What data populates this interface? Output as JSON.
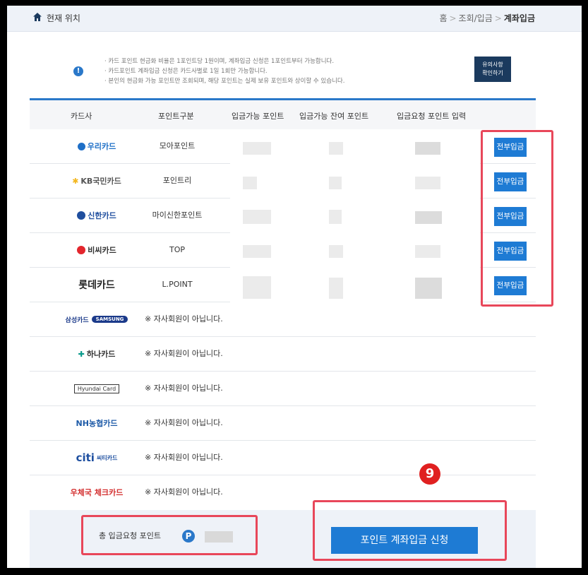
{
  "header": {
    "location_label": "현재 위치",
    "breadcrumb": [
      "홈",
      "조회/입금",
      "계좌입금"
    ],
    "separator": ">"
  },
  "notice": {
    "lines": [
      "· 카드 포인트 현금화 비율은 1포인트당 1원이며, 계좌입금 신청은 1포인트부터 가능합니다.",
      "· 카드포인트 계좌입금 신청은 카드사별로 1일 1회만 가능합니다.",
      "· 본인의 현금화 가능 포인트만 조회되며, 해당 포인트는 실제 보유 포인트와 상이할 수 있습니다."
    ],
    "caution_button": [
      "유의사항",
      "확인하기"
    ]
  },
  "table": {
    "headers": [
      "카드사",
      "포인트구분",
      "입금가능 포인트",
      "입금가능 잔여 포인트",
      "입금요청 포인트 입력"
    ],
    "member_rows": [
      {
        "card": "우리카드",
        "point_type": "모아포인트",
        "action": "전부입금"
      },
      {
        "card": "KB국민카드",
        "point_type": "포인트리",
        "action": "전부입금"
      },
      {
        "card": "신한카드",
        "point_type": "마이신한포인트",
        "action": "전부입금"
      },
      {
        "card": "비씨카드",
        "point_type": "TOP",
        "action": "전부입금"
      },
      {
        "card": "롯데카드",
        "point_type": "L.POINT",
        "action": "전부입금"
      }
    ],
    "nonmember_rows": [
      {
        "card": "삼성카드",
        "card_sub": "SAMSUNG",
        "status": "※ 자사회원이 아닙니다."
      },
      {
        "card": "하나카드",
        "status": "※ 자사회원이 아닙니다."
      },
      {
        "card": "Hyundai Card",
        "status": "※ 자사회원이 아닙니다."
      },
      {
        "card": "NH농협카드",
        "status": "※ 자사회원이 아닙니다."
      },
      {
        "card": "citi",
        "card_sub": "씨티카드",
        "status": "※ 자사회원이 아닙니다."
      },
      {
        "card": "우체국 체크카드",
        "status": "※ 자사회원이 아닙니다."
      }
    ]
  },
  "footer": {
    "total_label": "총 입금요청 포인트",
    "point_icon": "P",
    "apply_button": "포인트 계좌입금 신청"
  },
  "annotation": {
    "step_number": "9"
  },
  "colors": {
    "accent": "#1e7bd4",
    "highlight": "#e8475a",
    "step_badge": "#e02020"
  }
}
